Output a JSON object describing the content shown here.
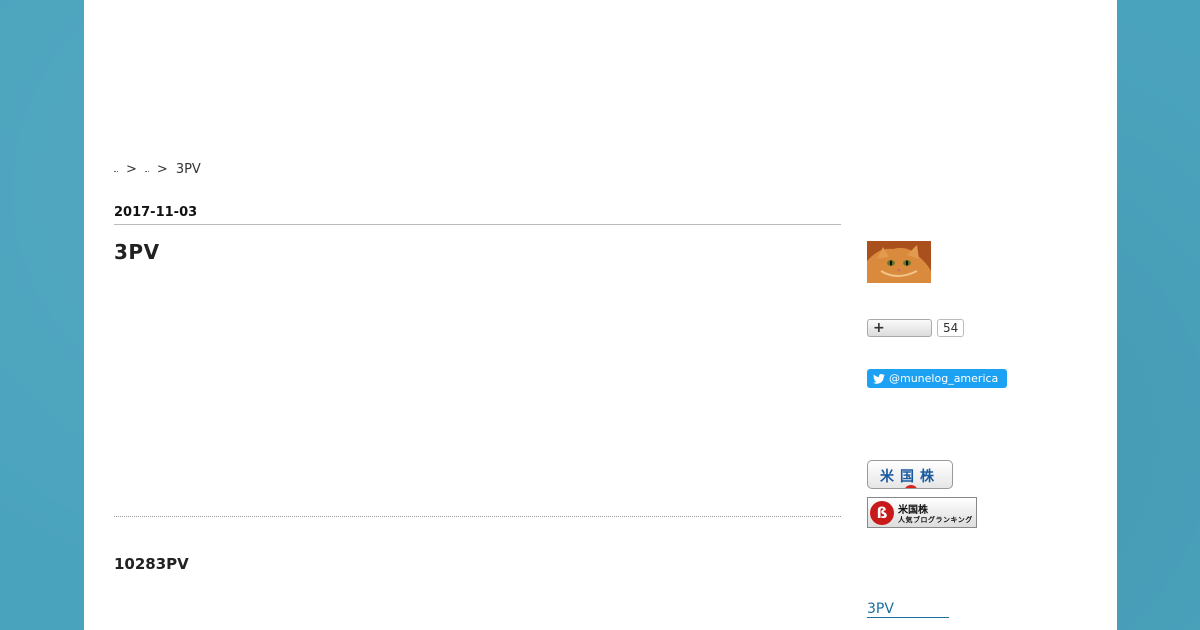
{
  "breadcrumb": {
    "current": "3PV",
    "separator": ">"
  },
  "article": {
    "date": "2017-11-03",
    "title": "3PV"
  },
  "next_entry": {
    "heading": "10283PV"
  },
  "sidebar": {
    "follow": {
      "plus": "+",
      "count": "54"
    },
    "twitter": {
      "handle": "@munelog_america",
      "color": "#1da1f2"
    },
    "badge_us_stocks": {
      "text": "米国株"
    },
    "badge_ranking": {
      "logo": "ß",
      "line1": "米国株",
      "line2": "人気ブログランキング"
    },
    "link": {
      "label": "3PV"
    }
  },
  "colors": {
    "background": "#4aa3bd",
    "page": "#ffffff",
    "link": "#1a6e9e"
  }
}
